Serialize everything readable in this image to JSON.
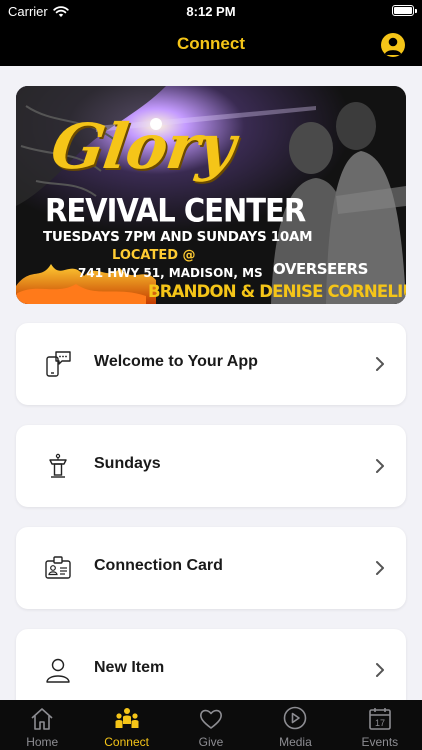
{
  "status_bar": {
    "carrier": "Carrier",
    "time": "8:12 PM"
  },
  "nav": {
    "title": "Connect",
    "profile_icon": "profile-icon"
  },
  "banner": {
    "title": "Glory",
    "subtitle": "REVIVAL CENTER",
    "schedule": "TUESDAYS 7PM AND SUNDAYS 10AM",
    "located_label": "LOCATED @",
    "address": "741 HWY 51, MADISON, MS",
    "overseers_label": "OVERSEERS",
    "names": "BRANDON & DENISE CORNELIUS"
  },
  "items": [
    {
      "label": "Welcome to Your App",
      "icon": "phone-message-icon"
    },
    {
      "label": "Sundays",
      "icon": "podium-icon"
    },
    {
      "label": "Connection Card",
      "icon": "id-card-icon"
    },
    {
      "label": "New Item",
      "icon": "person-icon"
    }
  ],
  "tabs": [
    {
      "label": "Home",
      "icon": "home-icon"
    },
    {
      "label": "Connect",
      "icon": "people-icon",
      "active": true
    },
    {
      "label": "Give",
      "icon": "heart-icon"
    },
    {
      "label": "Media",
      "icon": "play-icon"
    },
    {
      "label": "Events",
      "icon": "calendar-icon"
    }
  ],
  "calendar_day": "17",
  "colors": {
    "accent": "#f5c518",
    "background": "#f2f2f7",
    "bar": "#000000",
    "inactive": "#8d8d92"
  }
}
